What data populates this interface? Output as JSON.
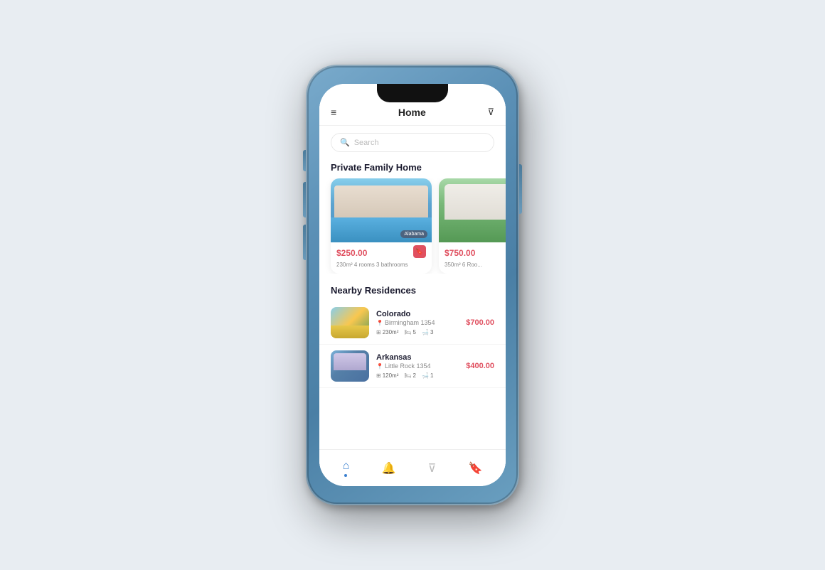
{
  "phone": {
    "header": {
      "title": "Home",
      "menu_icon": "≡",
      "filter_icon": "⊽"
    },
    "search": {
      "placeholder": "Search"
    },
    "sections": {
      "featured": {
        "title": "Private Family Home",
        "cards": [
          {
            "location_badge": "Alabama",
            "price": "$250.00",
            "details": "230m²  4 rooms  3 bathrooms",
            "bookmarked": true
          },
          {
            "location_badge": "",
            "price": "$750.00",
            "details": "350m²  6 Roo...",
            "bookmarked": false
          }
        ]
      },
      "nearby": {
        "title": "Nearby Residences",
        "items": [
          {
            "name": "Colorado",
            "address": "Birmingham 1354",
            "area": "230m²",
            "rooms": "5",
            "bathrooms": "3",
            "price": "$700.00"
          },
          {
            "name": "Arkansas",
            "address": "Little Rock 1354",
            "area": "120m²",
            "rooms": "2",
            "bathrooms": "1",
            "price": "$400.00"
          }
        ]
      }
    },
    "bottom_nav": {
      "items": [
        {
          "icon": "🏠",
          "label": "home",
          "active": true
        },
        {
          "icon": "🔔",
          "label": "notifications",
          "active": false
        },
        {
          "icon": "⊽",
          "label": "filter",
          "active": false
        },
        {
          "icon": "🔖",
          "label": "saved",
          "active": false
        }
      ]
    }
  }
}
